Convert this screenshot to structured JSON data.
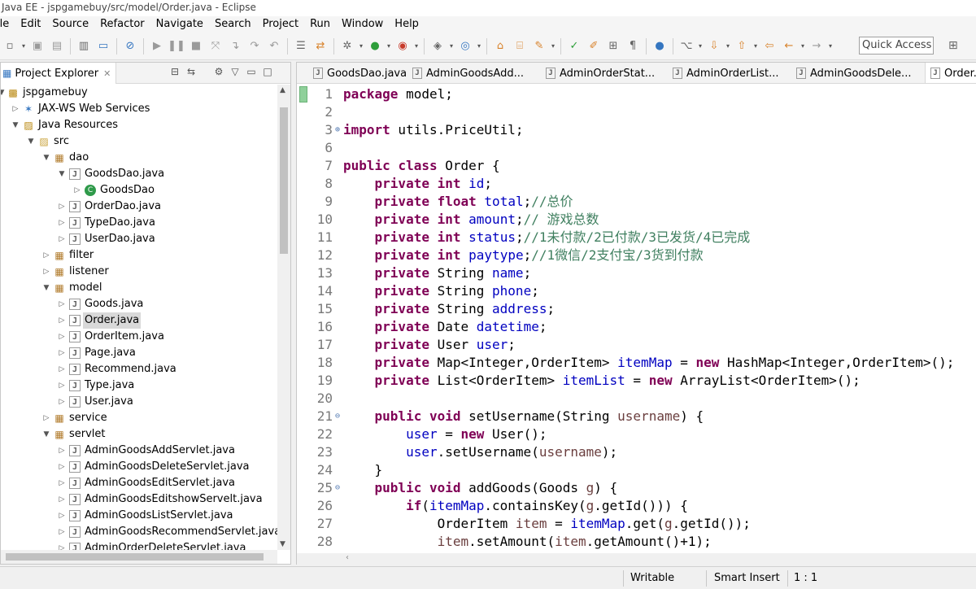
{
  "window": {
    "title": "Java EE - jspgamebuy/src/model/Order.java - Eclipse"
  },
  "menu": [
    "ile",
    "Edit",
    "Source",
    "Refactor",
    "Navigate",
    "Search",
    "Project",
    "Run",
    "Window",
    "Help"
  ],
  "toolbar": {
    "quick_access": "Quick Access"
  },
  "explorer": {
    "title": "Project Explorer",
    "tree": [
      {
        "label": "jspgamebuy",
        "icon": "project-icon",
        "depth": 0,
        "arrow": "open"
      },
      {
        "label": "JAX-WS Web Services",
        "icon": "web-services-icon",
        "depth": 1,
        "arrow": "closed"
      },
      {
        "label": "Java Resources",
        "icon": "java-resources-icon",
        "depth": 1,
        "arrow": "open"
      },
      {
        "label": "src",
        "icon": "source-folder-icon",
        "depth": 2,
        "arrow": "open"
      },
      {
        "label": "dao",
        "icon": "package-icon",
        "depth": 3,
        "arrow": "open"
      },
      {
        "label": "GoodsDao.java",
        "icon": "java-file-icon",
        "depth": 4,
        "arrow": "open"
      },
      {
        "label": "GoodsDao",
        "icon": "class-icon",
        "depth": 5,
        "arrow": "closed"
      },
      {
        "label": "OrderDao.java",
        "icon": "java-file-icon",
        "depth": 4,
        "arrow": "closed"
      },
      {
        "label": "TypeDao.java",
        "icon": "java-file-icon",
        "depth": 4,
        "arrow": "closed"
      },
      {
        "label": "UserDao.java",
        "icon": "java-file-icon",
        "depth": 4,
        "arrow": "closed"
      },
      {
        "label": "filter",
        "icon": "package-icon",
        "depth": 3,
        "arrow": "closed"
      },
      {
        "label": "listener",
        "icon": "package-icon",
        "depth": 3,
        "arrow": "closed"
      },
      {
        "label": "model",
        "icon": "package-icon",
        "depth": 3,
        "arrow": "open"
      },
      {
        "label": "Goods.java",
        "icon": "java-file-icon",
        "depth": 4,
        "arrow": "closed"
      },
      {
        "label": "Order.java",
        "icon": "java-file-icon",
        "depth": 4,
        "arrow": "closed",
        "selected": true
      },
      {
        "label": "OrderItem.java",
        "icon": "java-file-icon",
        "depth": 4,
        "arrow": "closed"
      },
      {
        "label": "Page.java",
        "icon": "java-file-icon",
        "depth": 4,
        "arrow": "closed"
      },
      {
        "label": "Recommend.java",
        "icon": "java-file-icon",
        "depth": 4,
        "arrow": "closed"
      },
      {
        "label": "Type.java",
        "icon": "java-file-icon",
        "depth": 4,
        "arrow": "closed"
      },
      {
        "label": "User.java",
        "icon": "java-file-icon",
        "depth": 4,
        "arrow": "closed"
      },
      {
        "label": "service",
        "icon": "package-icon",
        "depth": 3,
        "arrow": "closed"
      },
      {
        "label": "servlet",
        "icon": "package-icon",
        "depth": 3,
        "arrow": "open"
      },
      {
        "label": "AdminGoodsAddServlet.java",
        "icon": "java-file-icon",
        "depth": 4,
        "arrow": "closed"
      },
      {
        "label": "AdminGoodsDeleteServlet.java",
        "icon": "java-file-icon",
        "depth": 4,
        "arrow": "closed"
      },
      {
        "label": "AdminGoodsEditServlet.java",
        "icon": "java-file-icon",
        "depth": 4,
        "arrow": "closed"
      },
      {
        "label": "AdminGoodsEditshowServelt.java",
        "icon": "java-file-icon",
        "depth": 4,
        "arrow": "closed"
      },
      {
        "label": "AdminGoodsListServlet.java",
        "icon": "java-file-icon",
        "depth": 4,
        "arrow": "closed"
      },
      {
        "label": "AdminGoodsRecommendServlet.java",
        "icon": "java-file-icon",
        "depth": 4,
        "arrow": "closed"
      },
      {
        "label": "AdminOrderDeleteServlet.java",
        "icon": "java-file-icon",
        "depth": 4,
        "arrow": "closed"
      }
    ]
  },
  "editor": {
    "tabs": [
      {
        "label": "GoodsDao.java",
        "active": false
      },
      {
        "label": "AdminGoodsAdd...",
        "active": false
      },
      {
        "label": "AdminOrderStat...",
        "active": false
      },
      {
        "label": "AdminOrderList...",
        "active": false
      },
      {
        "label": "AdminGoodsDele...",
        "active": false
      },
      {
        "label": "Order.j",
        "active": true
      }
    ],
    "lines": [
      {
        "n": "1",
        "fold": "",
        "tokens": [
          [
            "kw",
            "package"
          ],
          [
            "t",
            " model;"
          ]
        ]
      },
      {
        "n": "2",
        "fold": "",
        "tokens": []
      },
      {
        "n": "3",
        "fold": "plus",
        "tokens": [
          [
            "kw",
            "import"
          ],
          [
            "t",
            " utils.PriceUtil;"
          ]
        ]
      },
      {
        "n": "6",
        "fold": "",
        "tokens": []
      },
      {
        "n": "7",
        "fold": "",
        "tokens": [
          [
            "kw",
            "public"
          ],
          [
            "t",
            " "
          ],
          [
            "kw",
            "class"
          ],
          [
            "t",
            " Order {"
          ]
        ]
      },
      {
        "n": "8",
        "fold": "",
        "tokens": [
          [
            "t",
            "    "
          ],
          [
            "kw",
            "private"
          ],
          [
            "t",
            " "
          ],
          [
            "kw",
            "int"
          ],
          [
            "t",
            " "
          ],
          [
            "fld",
            "id"
          ],
          [
            "t",
            ";"
          ]
        ]
      },
      {
        "n": "9",
        "fold": "",
        "tokens": [
          [
            "t",
            "    "
          ],
          [
            "kw",
            "private"
          ],
          [
            "t",
            " "
          ],
          [
            "kw",
            "float"
          ],
          [
            "t",
            " "
          ],
          [
            "fld",
            "total"
          ],
          [
            "t",
            ";"
          ],
          [
            "cmt",
            "//总价"
          ]
        ]
      },
      {
        "n": "10",
        "fold": "",
        "tokens": [
          [
            "t",
            "    "
          ],
          [
            "kw",
            "private"
          ],
          [
            "t",
            " "
          ],
          [
            "kw",
            "int"
          ],
          [
            "t",
            " "
          ],
          [
            "fld",
            "amount"
          ],
          [
            "t",
            ";"
          ],
          [
            "cmt",
            "// 游戏总数"
          ]
        ]
      },
      {
        "n": "11",
        "fold": "",
        "tokens": [
          [
            "t",
            "    "
          ],
          [
            "kw",
            "private"
          ],
          [
            "t",
            " "
          ],
          [
            "kw",
            "int"
          ],
          [
            "t",
            " "
          ],
          [
            "fld",
            "status"
          ],
          [
            "t",
            ";"
          ],
          [
            "cmt",
            "//1未付款/2已付款/3已发货/4已完成"
          ]
        ]
      },
      {
        "n": "12",
        "fold": "",
        "tokens": [
          [
            "t",
            "    "
          ],
          [
            "kw",
            "private"
          ],
          [
            "t",
            " "
          ],
          [
            "kw",
            "int"
          ],
          [
            "t",
            " "
          ],
          [
            "fld",
            "paytype"
          ],
          [
            "t",
            ";"
          ],
          [
            "cmt",
            "//1微信/2支付宝/3货到付款"
          ]
        ]
      },
      {
        "n": "13",
        "fold": "",
        "tokens": [
          [
            "t",
            "    "
          ],
          [
            "kw",
            "private"
          ],
          [
            "t",
            " String "
          ],
          [
            "fld",
            "name"
          ],
          [
            "t",
            ";"
          ]
        ]
      },
      {
        "n": "14",
        "fold": "",
        "tokens": [
          [
            "t",
            "    "
          ],
          [
            "kw",
            "private"
          ],
          [
            "t",
            " String "
          ],
          [
            "fld",
            "phone"
          ],
          [
            "t",
            ";"
          ]
        ]
      },
      {
        "n": "15",
        "fold": "",
        "tokens": [
          [
            "t",
            "    "
          ],
          [
            "kw",
            "private"
          ],
          [
            "t",
            " String "
          ],
          [
            "fld",
            "address"
          ],
          [
            "t",
            ";"
          ]
        ]
      },
      {
        "n": "16",
        "fold": "",
        "tokens": [
          [
            "t",
            "    "
          ],
          [
            "kw",
            "private"
          ],
          [
            "t",
            " Date "
          ],
          [
            "fld",
            "datetime"
          ],
          [
            "t",
            ";"
          ]
        ]
      },
      {
        "n": "17",
        "fold": "",
        "tokens": [
          [
            "t",
            "    "
          ],
          [
            "kw",
            "private"
          ],
          [
            "t",
            " User "
          ],
          [
            "fld",
            "user"
          ],
          [
            "t",
            ";"
          ]
        ]
      },
      {
        "n": "18",
        "fold": "",
        "tokens": [
          [
            "t",
            "    "
          ],
          [
            "kw",
            "private"
          ],
          [
            "t",
            " Map<Integer,OrderItem> "
          ],
          [
            "fld",
            "itemMap"
          ],
          [
            "t",
            " = "
          ],
          [
            "kw",
            "new"
          ],
          [
            "t",
            " HashMap<Integer,OrderItem>();"
          ]
        ]
      },
      {
        "n": "19",
        "fold": "",
        "tokens": [
          [
            "t",
            "    "
          ],
          [
            "kw",
            "private"
          ],
          [
            "t",
            " List<OrderItem> "
          ],
          [
            "fld",
            "itemList"
          ],
          [
            "t",
            " = "
          ],
          [
            "kw",
            "new"
          ],
          [
            "t",
            " ArrayList<OrderItem>();"
          ]
        ]
      },
      {
        "n": "20",
        "fold": "",
        "tokens": []
      },
      {
        "n": "21",
        "fold": "minus",
        "tokens": [
          [
            "t",
            "    "
          ],
          [
            "kw",
            "public"
          ],
          [
            "t",
            " "
          ],
          [
            "kw",
            "void"
          ],
          [
            "t",
            " setUsername(String "
          ],
          [
            "par",
            "username"
          ],
          [
            "t",
            ") {"
          ]
        ]
      },
      {
        "n": "22",
        "fold": "",
        "tokens": [
          [
            "t",
            "        "
          ],
          [
            "fld",
            "user"
          ],
          [
            "t",
            " = "
          ],
          [
            "kw",
            "new"
          ],
          [
            "t",
            " User();"
          ]
        ]
      },
      {
        "n": "23",
        "fold": "",
        "tokens": [
          [
            "t",
            "        "
          ],
          [
            "fld",
            "user"
          ],
          [
            "t",
            ".setUsername("
          ],
          [
            "par",
            "username"
          ],
          [
            "t",
            ");"
          ]
        ]
      },
      {
        "n": "24",
        "fold": "",
        "tokens": [
          [
            "t",
            "    }"
          ]
        ]
      },
      {
        "n": "25",
        "fold": "minus",
        "tokens": [
          [
            "t",
            "    "
          ],
          [
            "kw",
            "public"
          ],
          [
            "t",
            " "
          ],
          [
            "kw",
            "void"
          ],
          [
            "t",
            " addGoods(Goods "
          ],
          [
            "par",
            "g"
          ],
          [
            "t",
            ") {"
          ]
        ]
      },
      {
        "n": "26",
        "fold": "",
        "tokens": [
          [
            "t",
            "        "
          ],
          [
            "kw",
            "if"
          ],
          [
            "t",
            "("
          ],
          [
            "fld",
            "itemMap"
          ],
          [
            "t",
            ".containsKey("
          ],
          [
            "par",
            "g"
          ],
          [
            "t",
            ".getId())) {"
          ]
        ]
      },
      {
        "n": "27",
        "fold": "",
        "tokens": [
          [
            "t",
            "            OrderItem "
          ],
          [
            "par",
            "item"
          ],
          [
            "t",
            " = "
          ],
          [
            "fld",
            "itemMap"
          ],
          [
            "t",
            ".get("
          ],
          [
            "par",
            "g"
          ],
          [
            "t",
            ".getId());"
          ]
        ]
      },
      {
        "n": "28",
        "fold": "",
        "tokens": [
          [
            "t",
            "            "
          ],
          [
            "par",
            "item"
          ],
          [
            "t",
            ".setAmount("
          ],
          [
            "par",
            "item"
          ],
          [
            "t",
            ".getAmount()+1);"
          ]
        ]
      }
    ]
  },
  "status": {
    "writable": "Writable",
    "insert_mode": "Smart Insert",
    "position": "1 : 1"
  }
}
